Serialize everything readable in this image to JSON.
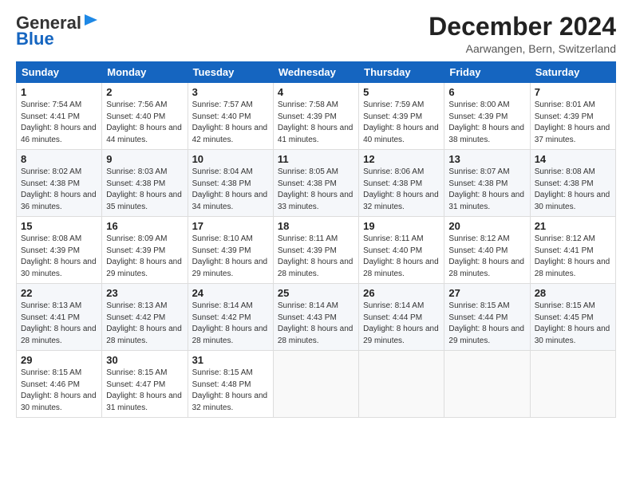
{
  "header": {
    "logo_line1": "General",
    "logo_line2": "Blue",
    "month": "December 2024",
    "location": "Aarwangen, Bern, Switzerland"
  },
  "days_of_week": [
    "Sunday",
    "Monday",
    "Tuesday",
    "Wednesday",
    "Thursday",
    "Friday",
    "Saturday"
  ],
  "weeks": [
    [
      {
        "day": "1",
        "sunrise": "7:54 AM",
        "sunset": "4:41 PM",
        "daylight": "8 hours and 46 minutes."
      },
      {
        "day": "2",
        "sunrise": "7:56 AM",
        "sunset": "4:40 PM",
        "daylight": "8 hours and 44 minutes."
      },
      {
        "day": "3",
        "sunrise": "7:57 AM",
        "sunset": "4:40 PM",
        "daylight": "8 hours and 42 minutes."
      },
      {
        "day": "4",
        "sunrise": "7:58 AM",
        "sunset": "4:39 PM",
        "daylight": "8 hours and 41 minutes."
      },
      {
        "day": "5",
        "sunrise": "7:59 AM",
        "sunset": "4:39 PM",
        "daylight": "8 hours and 40 minutes."
      },
      {
        "day": "6",
        "sunrise": "8:00 AM",
        "sunset": "4:39 PM",
        "daylight": "8 hours and 38 minutes."
      },
      {
        "day": "7",
        "sunrise": "8:01 AM",
        "sunset": "4:39 PM",
        "daylight": "8 hours and 37 minutes."
      }
    ],
    [
      {
        "day": "8",
        "sunrise": "8:02 AM",
        "sunset": "4:38 PM",
        "daylight": "8 hours and 36 minutes."
      },
      {
        "day": "9",
        "sunrise": "8:03 AM",
        "sunset": "4:38 PM",
        "daylight": "8 hours and 35 minutes."
      },
      {
        "day": "10",
        "sunrise": "8:04 AM",
        "sunset": "4:38 PM",
        "daylight": "8 hours and 34 minutes."
      },
      {
        "day": "11",
        "sunrise": "8:05 AM",
        "sunset": "4:38 PM",
        "daylight": "8 hours and 33 minutes."
      },
      {
        "day": "12",
        "sunrise": "8:06 AM",
        "sunset": "4:38 PM",
        "daylight": "8 hours and 32 minutes."
      },
      {
        "day": "13",
        "sunrise": "8:07 AM",
        "sunset": "4:38 PM",
        "daylight": "8 hours and 31 minutes."
      },
      {
        "day": "14",
        "sunrise": "8:08 AM",
        "sunset": "4:38 PM",
        "daylight": "8 hours and 30 minutes."
      }
    ],
    [
      {
        "day": "15",
        "sunrise": "8:08 AM",
        "sunset": "4:39 PM",
        "daylight": "8 hours and 30 minutes."
      },
      {
        "day": "16",
        "sunrise": "8:09 AM",
        "sunset": "4:39 PM",
        "daylight": "8 hours and 29 minutes."
      },
      {
        "day": "17",
        "sunrise": "8:10 AM",
        "sunset": "4:39 PM",
        "daylight": "8 hours and 29 minutes."
      },
      {
        "day": "18",
        "sunrise": "8:11 AM",
        "sunset": "4:39 PM",
        "daylight": "8 hours and 28 minutes."
      },
      {
        "day": "19",
        "sunrise": "8:11 AM",
        "sunset": "4:40 PM",
        "daylight": "8 hours and 28 minutes."
      },
      {
        "day": "20",
        "sunrise": "8:12 AM",
        "sunset": "4:40 PM",
        "daylight": "8 hours and 28 minutes."
      },
      {
        "day": "21",
        "sunrise": "8:12 AM",
        "sunset": "4:41 PM",
        "daylight": "8 hours and 28 minutes."
      }
    ],
    [
      {
        "day": "22",
        "sunrise": "8:13 AM",
        "sunset": "4:41 PM",
        "daylight": "8 hours and 28 minutes."
      },
      {
        "day": "23",
        "sunrise": "8:13 AM",
        "sunset": "4:42 PM",
        "daylight": "8 hours and 28 minutes."
      },
      {
        "day": "24",
        "sunrise": "8:14 AM",
        "sunset": "4:42 PM",
        "daylight": "8 hours and 28 minutes."
      },
      {
        "day": "25",
        "sunrise": "8:14 AM",
        "sunset": "4:43 PM",
        "daylight": "8 hours and 28 minutes."
      },
      {
        "day": "26",
        "sunrise": "8:14 AM",
        "sunset": "4:44 PM",
        "daylight": "8 hours and 29 minutes."
      },
      {
        "day": "27",
        "sunrise": "8:15 AM",
        "sunset": "4:44 PM",
        "daylight": "8 hours and 29 minutes."
      },
      {
        "day": "28",
        "sunrise": "8:15 AM",
        "sunset": "4:45 PM",
        "daylight": "8 hours and 30 minutes."
      }
    ],
    [
      {
        "day": "29",
        "sunrise": "8:15 AM",
        "sunset": "4:46 PM",
        "daylight": "8 hours and 30 minutes."
      },
      {
        "day": "30",
        "sunrise": "8:15 AM",
        "sunset": "4:47 PM",
        "daylight": "8 hours and 31 minutes."
      },
      {
        "day": "31",
        "sunrise": "8:15 AM",
        "sunset": "4:48 PM",
        "daylight": "8 hours and 32 minutes."
      },
      null,
      null,
      null,
      null
    ]
  ],
  "labels": {
    "sunrise": "Sunrise:",
    "sunset": "Sunset:",
    "daylight": "Daylight:"
  }
}
